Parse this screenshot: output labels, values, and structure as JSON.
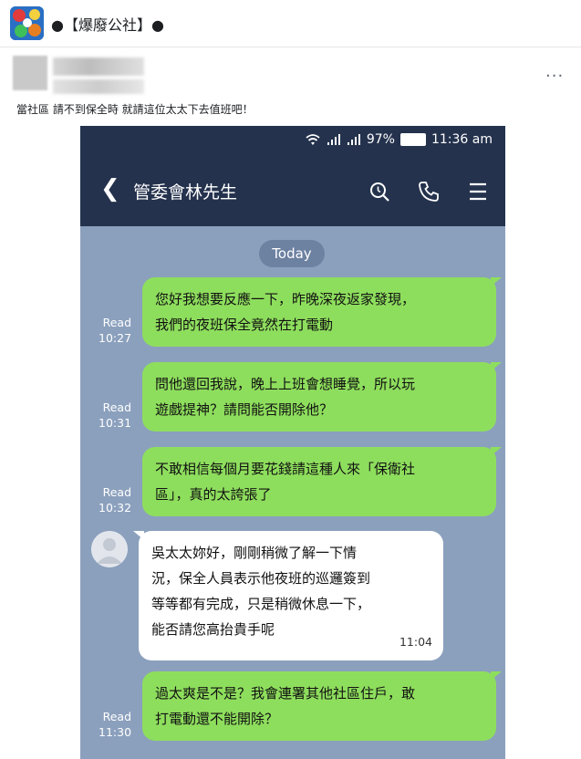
{
  "header": {
    "page_name": "●【爆廢公社】●"
  },
  "post": {
    "more_label": "···",
    "text": "當社區 請不到保全時 就請這位太太下去值班吧！"
  },
  "phone": {
    "status": {
      "battery": "97%",
      "time": "11:36 am"
    },
    "chat_title": "管委會林先生",
    "date_label": "Today",
    "messages": [
      {
        "dir": "out",
        "read": "Read",
        "time": "10:27",
        "lines": [
          "您好我想要反應一下，昨晚深夜返家發現，",
          "我們的夜班保全竟然在打電動"
        ]
      },
      {
        "dir": "out",
        "read": "Read",
        "time": "10:31",
        "lines": [
          "問他還回我說，晚上上班會想睡覺，所以玩",
          "遊戲提神？請問能否開除他？"
        ]
      },
      {
        "dir": "out",
        "read": "Read",
        "time": "10:32",
        "lines": [
          "不敢相信每個月要花錢請這種人來「保衛社",
          "區」，真的太誇張了"
        ]
      },
      {
        "dir": "in",
        "time": "11:04",
        "lines": [
          "吳太太妳好，剛剛稍微了解一下情",
          "況，保全人員表示他夜班的巡邏簽到",
          "等等都有完成，只是稍微休息一下，",
          "能否請您高抬貴手呢"
        ]
      },
      {
        "dir": "out",
        "read": "Read",
        "time": "11:30",
        "lines": [
          "過太爽是不是？我會連署其他社區住戶，敢",
          "打電動還不能開除？"
        ]
      }
    ]
  },
  "colors": {
    "chat_bg": "#8ba0bd",
    "nav_bg": "#24324d",
    "outgoing": "#8ede5d",
    "incoming": "#ffffff"
  },
  "icons": [
    "back-icon",
    "search-icon",
    "phone-icon",
    "menu-icon",
    "wifi-icon",
    "signal-icon"
  ]
}
